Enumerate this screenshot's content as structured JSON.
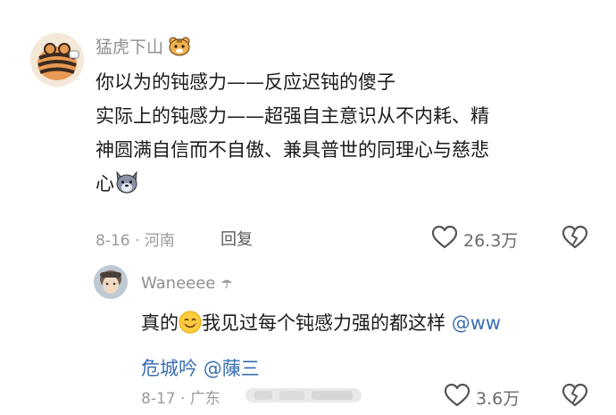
{
  "comment": {
    "username": "猛虎下山",
    "lines": [
      "你以为的钝感力——反应迟钝的傻子",
      "实际上的钝感力——超强自主意识从不内耗、精",
      "神圆满自信而不自傲、兼具普世的同理心与慈悲",
      "心"
    ],
    "date": "8-16",
    "location": "河南",
    "reply_label": "回复",
    "likes": "26.3万"
  },
  "reply": {
    "username": "Waneeee",
    "text_before": "真的",
    "text_after": "我见过每个钝感力强的都这样",
    "mention1_part1": "@ww",
    "mention1_part2": "危城吟",
    "mention2": "@蔯三",
    "date": "8-17",
    "location": "广东",
    "likes": "3.6万"
  },
  "icons": {
    "tiger_emoji": "tiger-face-icon",
    "wolf_emoji": "wolf-face-icon",
    "smile_emoji": "smiling-face-icon",
    "heart": "heart-outline-icon",
    "broken_heart": "broken-heart-icon",
    "umbrella": "umbrella-icon"
  },
  "colors": {
    "mention": "#3a6fb0",
    "meta_text": "#9a9a9a",
    "username": "#8f8f8f"
  }
}
